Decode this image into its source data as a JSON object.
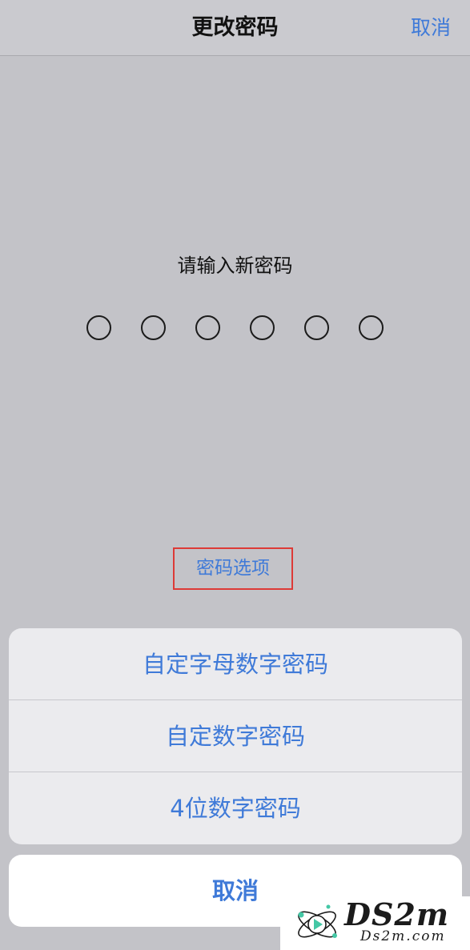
{
  "nav": {
    "title": "更改密码",
    "cancel_label": "取消"
  },
  "passcode": {
    "prompt": "请输入新密码",
    "digit_count": 6,
    "filled_count": 0
  },
  "options_link": {
    "label": "密码选项"
  },
  "action_sheet": {
    "items": [
      {
        "label": "自定字母数字密码"
      },
      {
        "label": "自定数字密码"
      },
      {
        "label": "4位数字密码"
      }
    ],
    "cancel_label": "取消"
  },
  "watermark": {
    "main": "DS2m",
    "sub": "Ds2m.com"
  },
  "colors": {
    "accent": "#3f7ad8",
    "highlight_border": "#dd3a37",
    "background": "#c3c3c8"
  }
}
